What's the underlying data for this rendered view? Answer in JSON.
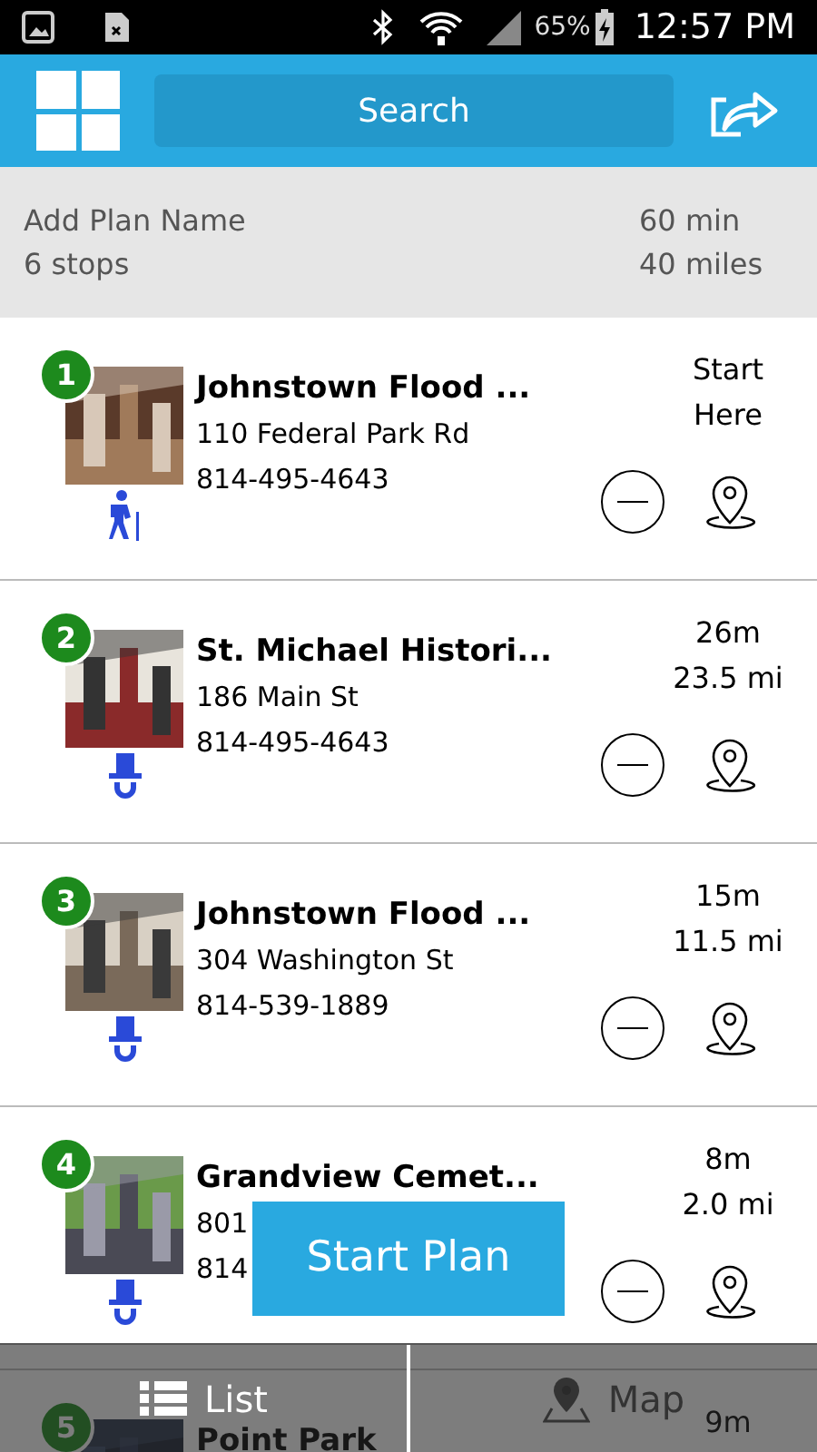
{
  "status_bar": {
    "battery": "65%",
    "time": "12:57 PM"
  },
  "header": {
    "search": {
      "placeholder": "Search"
    }
  },
  "plan": {
    "name_placeholder": "Add Plan Name",
    "stops": "6 stops",
    "duration": "60 min",
    "distance": "40 miles"
  },
  "stops": [
    {
      "number": "1",
      "name": "Johnstown Flood ...",
      "address": "110 Federal Park Rd",
      "phone": "814-495-4643",
      "info": [
        "Start",
        "Here"
      ],
      "kind": "hiker"
    },
    {
      "number": "2",
      "name": "St. Michael Histori...",
      "address": "186 Main St",
      "phone": "814-495-4643",
      "info": [
        "26m",
        "23.5 mi"
      ],
      "kind": "hat"
    },
    {
      "number": "3",
      "name": "Johnstown Flood ...",
      "address": "304 Washington St",
      "phone": "814-539-1889",
      "info": [
        "15m",
        "11.5 mi"
      ],
      "kind": "hat"
    },
    {
      "number": "4",
      "name": "Grandview Cemet...",
      "address": "801",
      "phone": "814",
      "info": [
        "8m",
        "2.0 mi"
      ],
      "kind": "hat"
    },
    {
      "number": "5",
      "name": "Point Park",
      "info": [
        "9m"
      ]
    }
  ],
  "start_button": "Start Plan",
  "bottom_tabs": [
    {
      "label": "List",
      "selected": true,
      "kind": "list"
    },
    {
      "label": "Map",
      "selected": false,
      "kind": "map"
    }
  ]
}
